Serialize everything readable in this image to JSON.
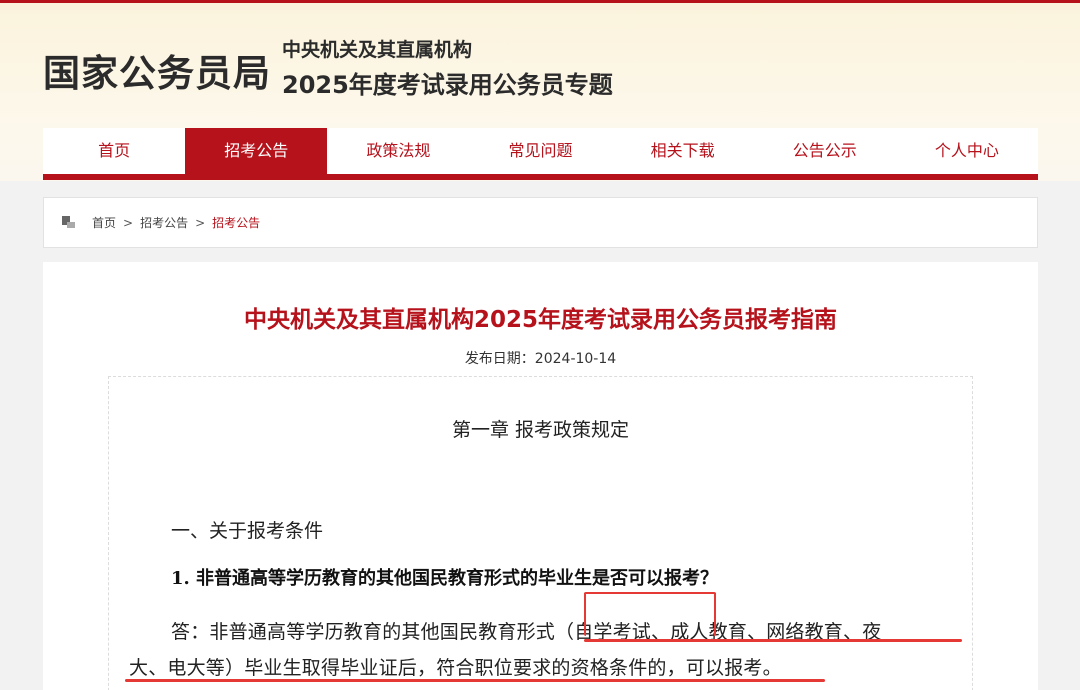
{
  "header": {
    "site_title": "国家公务员局",
    "subtitle_line1": "中央机关及其直属机构",
    "subtitle_line2": "2025年度考试录用公务员专题"
  },
  "nav": {
    "items": [
      {
        "label": "首页",
        "active": false
      },
      {
        "label": "招考公告",
        "active": true
      },
      {
        "label": "政策法规",
        "active": false
      },
      {
        "label": "常见问题",
        "active": false
      },
      {
        "label": "相关下载",
        "active": false
      },
      {
        "label": "公告公示",
        "active": false
      },
      {
        "label": "个人中心",
        "active": false
      }
    ]
  },
  "breadcrumb": {
    "icon": "home-icon",
    "items": [
      "首页",
      "招考公告",
      "招考公告"
    ],
    "separator": ">"
  },
  "article": {
    "title": "中央机关及其直属机构2025年度考试录用公务员报考指南",
    "publish_date": "发布日期：2024-10-14",
    "chapter": "第一章  报考政策规定",
    "section": "一、关于报考条件",
    "question": "1. 非普通高等学历教育的其他国民教育形式的毕业生是否可以报考？",
    "answer_line1": "答：非普通高等学历教育的其他国民教育形式（自学考试、成人教育、网络教育、夜",
    "answer_line2": "大、电大等）毕业生取得毕业证后，符合职位要求的资格条件的，可以报考。"
  },
  "colors": {
    "brand_red": "#b5121b",
    "annotation_red": "#e53935",
    "header_bg": "#fbf3dc"
  }
}
